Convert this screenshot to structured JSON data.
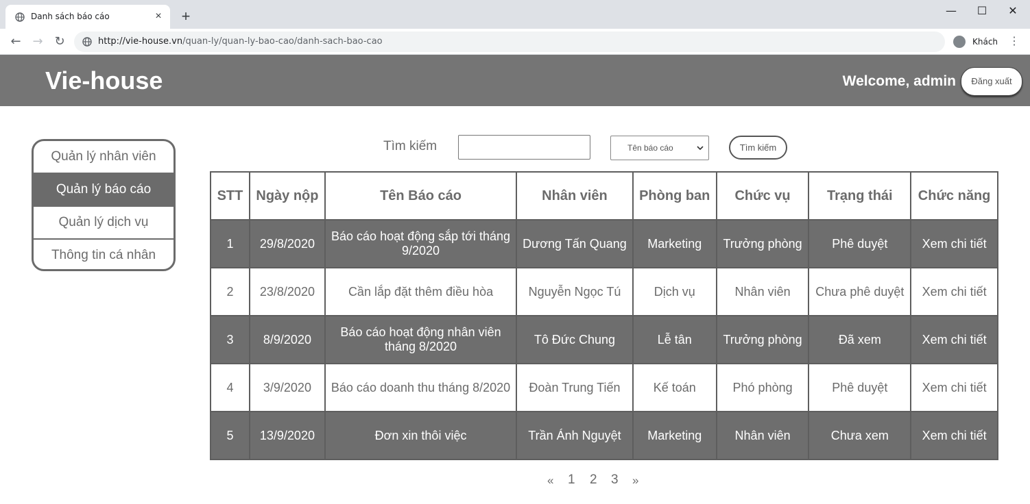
{
  "browser": {
    "tab_title": "Danh sách báo cáo",
    "tab_close": "×",
    "new_tab": "+",
    "url_host": "http://vie-house.vn",
    "url_path": "/quan-ly/quan-ly-bao-cao/danh-sach-bao-cao",
    "profile_label": "Khách",
    "window_minimize": "—",
    "window_maximize": "☐",
    "window_close": "✕",
    "back": "←",
    "forward": "→",
    "reload": "↻",
    "menu": "⋮"
  },
  "header": {
    "logo": "Vie-house",
    "welcome": "Welcome, admin",
    "logout_label": "Đăng xuất"
  },
  "sidebar": {
    "items": [
      {
        "label": "Quản lý nhân viên",
        "active": false
      },
      {
        "label": "Quản lý báo cáo",
        "active": true
      },
      {
        "label": "Quản lý dịch vụ",
        "active": false
      },
      {
        "label": "Thông tin cá nhân",
        "active": false
      }
    ]
  },
  "search": {
    "label": "Tìm kiếm",
    "input_value": "",
    "select_value": "Tên báo cáo",
    "button_label": "Tìm kiếm"
  },
  "table": {
    "headers": [
      "STT",
      "Ngày nộp",
      "Tên Báo cáo",
      "Nhân viên",
      "Phòng ban",
      "Chức vụ",
      "Trạng thái",
      "Chức năng"
    ],
    "rows": [
      {
        "stt": "1",
        "date": "29/8/2020",
        "title": "Báo cáo hoạt động sắp tới tháng 9/2020",
        "employee": "Dương Tấn Quang",
        "department": "Marketing",
        "position": "Trưởng phòng",
        "status": "Phê duyệt",
        "action": "Xem chi tiết"
      },
      {
        "stt": "2",
        "date": "23/8/2020",
        "title": "Cần lắp đặt thêm điều hòa",
        "employee": "Nguyễn Ngọc Tú",
        "department": "Dịch vụ",
        "position": "Nhân viên",
        "status": "Chưa phê duyệt",
        "action": "Xem chi tiết"
      },
      {
        "stt": "3",
        "date": "8/9/2020",
        "title": "Báo cáo hoạt động nhân viên tháng 8/2020",
        "employee": "Tô Đức Chung",
        "department": "Lễ tân",
        "position": "Trưởng phòng",
        "status": "Đã xem",
        "action": "Xem chi tiết"
      },
      {
        "stt": "4",
        "date": "3/9/2020",
        "title": "Báo cáo doanh thu tháng 8/2020",
        "employee": "Đoàn Trung Tiến",
        "department": "Kế toán",
        "position": "Phó phòng",
        "status": "Phê duyệt",
        "action": "Xem chi tiết"
      },
      {
        "stt": "5",
        "date": "13/9/2020",
        "title": "Đơn xin thôi việc",
        "employee": "Trần Ánh Nguyệt",
        "department": "Marketing",
        "position": "Nhân viên",
        "status": "Chưa xem",
        "action": "Xem chi tiết"
      }
    ]
  },
  "pagination": {
    "prev": "«",
    "pages": [
      "1",
      "2",
      "3"
    ],
    "next": "»"
  },
  "colors": {
    "header_bg": "#757575",
    "dark_row": "#6e6e6e",
    "text_gray": "#6b6b6b"
  }
}
